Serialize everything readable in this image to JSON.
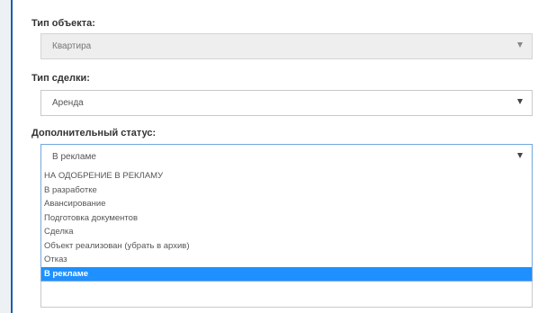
{
  "fields": {
    "object_type": {
      "label": "Тип объекта:",
      "value": "Квартира"
    },
    "deal_type": {
      "label": "Тип сделки:",
      "value": "Аренда"
    },
    "extra_status": {
      "label": "Дополнительный статус:",
      "value": "В рекламе",
      "options": [
        "НА ОДОБРЕНИЕ В РЕКЛАМУ",
        "В разработке",
        "Авансирование",
        "Подготовка документов",
        "Сделка",
        "Объект реализован (убрать в архив)",
        "Отказ",
        "В рекламе"
      ],
      "selected_index": 7
    }
  },
  "colors": {
    "accent": "#1a5ea8",
    "selected_option": "#1e90ff"
  }
}
